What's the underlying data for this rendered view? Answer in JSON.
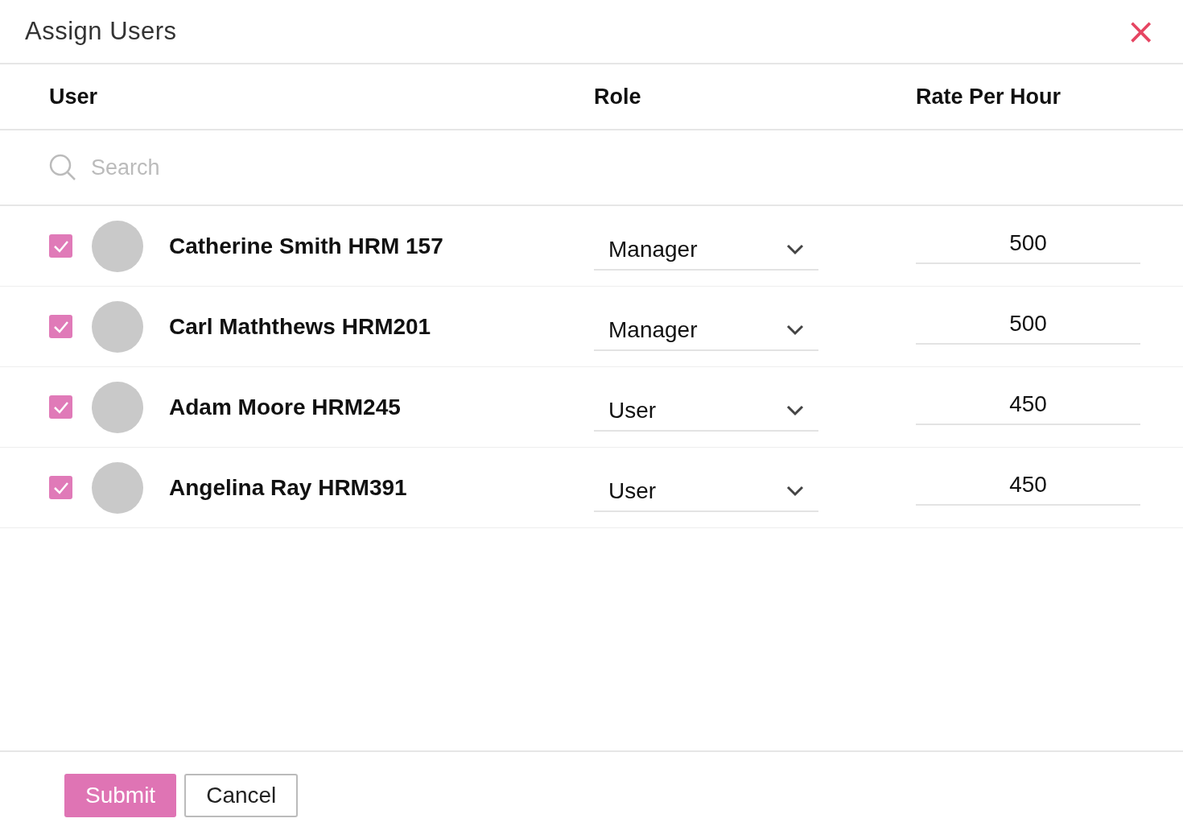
{
  "dialog": {
    "title": "Assign Users",
    "close": "×"
  },
  "columns": [
    "User",
    "Role",
    "Rate Per Hour"
  ],
  "search": {
    "placeholder": "Search"
  },
  "rows": [
    {
      "checked": true,
      "name": "Catherine Smith HRM 157",
      "role": "Manager",
      "rate": "500"
    },
    {
      "checked": true,
      "name": "Carl Maththews HRM201",
      "role": "Manager",
      "rate": "500"
    },
    {
      "checked": true,
      "name": "Adam Moore HRM245",
      "role": "User",
      "rate": "450"
    },
    {
      "checked": true,
      "name": "Angelina Ray HRM391",
      "role": "User",
      "rate": "450"
    }
  ],
  "buttons": [
    {
      "label": "Submit",
      "kind": "primary"
    },
    {
      "label": "Cancel",
      "kind": "secondary"
    }
  ]
}
